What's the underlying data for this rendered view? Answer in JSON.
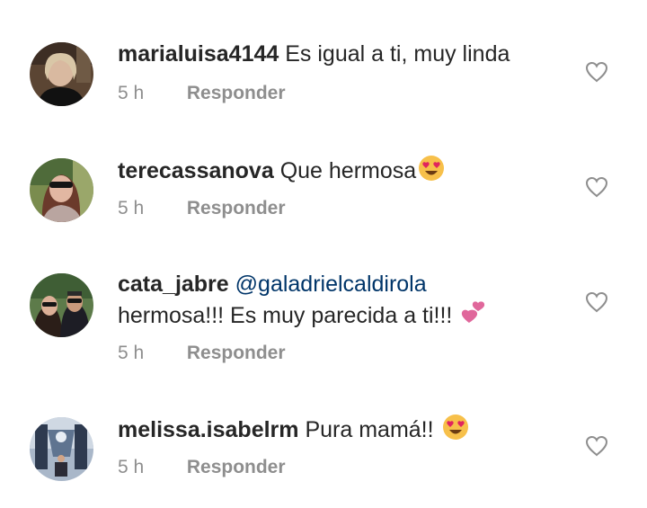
{
  "comments": [
    {
      "username": "marialuisa4144",
      "text": "Es igual a ti, muy linda",
      "time": "5 h",
      "reply_label": "Responder",
      "avatar_icon": "user-avatar-icon",
      "emoji_icon": ""
    },
    {
      "username": "terecassanova",
      "text": "Que hermosa",
      "time": "5 h",
      "reply_label": "Responder",
      "avatar_icon": "user-avatar-icon",
      "emoji_icon": "heart-eyes-emoji-icon"
    },
    {
      "username": "cata_jabre",
      "mention": "@galadrielcaldirola",
      "text": "hermosa!!! Es muy parecida a ti!!!",
      "time": "5 h",
      "reply_label": "Responder",
      "avatar_icon": "user-avatar-icon",
      "emoji_icon": "two-hearts-emoji-icon"
    },
    {
      "username": "melissa.isabelrm",
      "text": "Pura mamá!!",
      "time": "5 h",
      "reply_label": "Responder",
      "avatar_icon": "user-avatar-icon",
      "emoji_icon": "heart-eyes-emoji-icon"
    }
  ],
  "colors": {
    "text": "#262626",
    "muted": "#8e8e8e",
    "mention": "#003569",
    "emoji_yellow": "#f7c04a",
    "emoji_hearts": "#e0245e",
    "two_hearts": "#e0679b"
  }
}
